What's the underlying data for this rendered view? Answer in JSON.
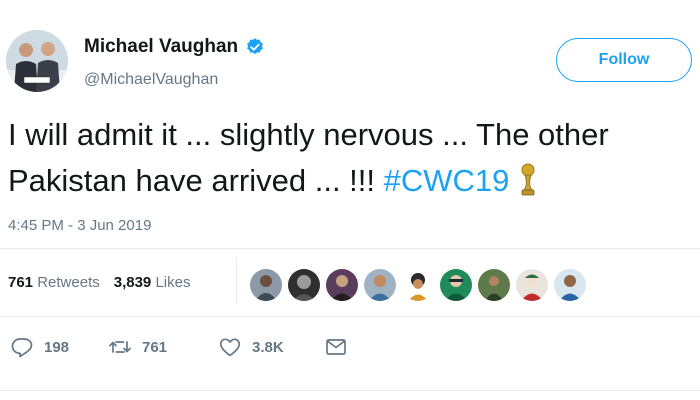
{
  "author": {
    "name": "Michael Vaughan",
    "handle": "@MichaelVaughan",
    "verified": true
  },
  "follow_label": "Follow",
  "tweet": {
    "line1": "I will admit it ... slightly nervous ... The other",
    "line2_text": "Pakistan have arrived ... !!! ",
    "hashtag": "#CWC19",
    "timestamp": "4:45 PM - 3 Jun 2019"
  },
  "stats": {
    "retweets_count": "761",
    "retweets_label": "Retweets",
    "likes_count": "3,839",
    "likes_label": "Likes"
  },
  "actions": {
    "reply_count": "198",
    "retweet_count": "761",
    "like_count": "3.8K"
  },
  "colors": {
    "accent": "#1da1f2",
    "muted": "#657786",
    "text": "#14171a",
    "divider": "#e6ecf0"
  },
  "icons": {
    "verified": "verified-badge-icon",
    "trophy": "trophy-icon",
    "reply": "reply-icon",
    "retweet": "retweet-icon",
    "like": "heart-icon",
    "message": "envelope-icon"
  }
}
